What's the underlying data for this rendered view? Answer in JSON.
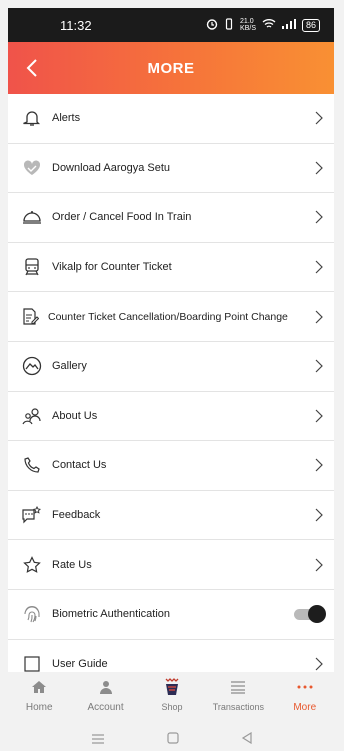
{
  "status": {
    "time": "11:32",
    "net_speed": "21.0",
    "net_unit": "KB/S",
    "battery": "86"
  },
  "header": {
    "title": "MORE"
  },
  "menu": [
    {
      "label": "Alerts",
      "icon": "bell-icon"
    },
    {
      "label": "Download Aarogya Setu",
      "icon": "heart-icon"
    },
    {
      "label": "Order / Cancel Food In Train",
      "icon": "food-cloche-icon"
    },
    {
      "label": "Vikalp for Counter Ticket",
      "icon": "train-icon"
    },
    {
      "label": "Counter Ticket Cancellation/Boarding Point Change",
      "icon": "ticket-edit-icon"
    },
    {
      "label": "Gallery",
      "icon": "gallery-icon"
    },
    {
      "label": "About Us",
      "icon": "people-icon"
    },
    {
      "label": "Contact Us",
      "icon": "phone-icon"
    },
    {
      "label": "Feedback",
      "icon": "feedback-icon"
    },
    {
      "label": "Rate Us",
      "icon": "star-icon"
    },
    {
      "label": "Biometric Authentication",
      "icon": "fingerprint-icon",
      "toggle": true
    },
    {
      "label": "User Guide",
      "icon": "guide-icon"
    }
  ],
  "nav": [
    {
      "label": "Home",
      "icon": "home-icon"
    },
    {
      "label": "Account",
      "icon": "account-icon"
    },
    {
      "label": "Shop",
      "icon": "shop-icon"
    },
    {
      "label": "Transactions",
      "icon": "transactions-icon"
    },
    {
      "label": "More",
      "icon": "more-dots-icon",
      "active": true
    }
  ],
  "colors": {
    "accent": "#e8582e",
    "header_start": "#f0534a",
    "header_end": "#f99033"
  }
}
